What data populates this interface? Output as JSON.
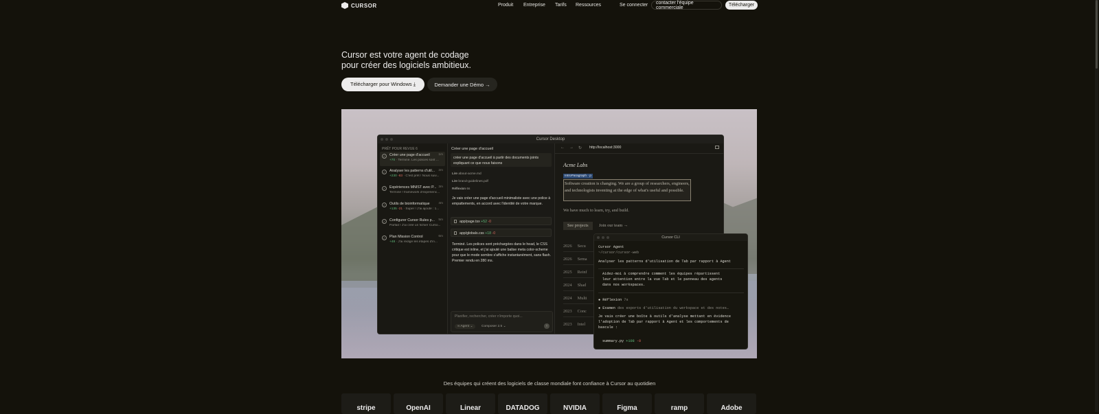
{
  "nav": {
    "logo_text": "CURSOR",
    "links": [
      "Produit",
      "Entreprise",
      "Tarifs",
      "Ressources"
    ],
    "connect": "Se connecter",
    "contact": "contacter l'équipe commerciale",
    "download": "Télécharger"
  },
  "hero": {
    "title_line1": "Cursor est votre agent de codage",
    "title_line2": "pour créer des logiciels ambitieux.",
    "primary_button": "Télécharger pour Windows ⤓",
    "secondary_button": "Demander une Démo →"
  },
  "desktop": {
    "window_title": "Cursor Desktop",
    "sidebar": {
      "heading": "PRÊT POUR REVUE 6",
      "items": [
        {
          "title": "Créer une page d'accueil",
          "added": "+70",
          "removed": "",
          "sub": "· Terminé. Les polices sont ...",
          "time": "1m"
        },
        {
          "title": "Analyser les patterns d'util...",
          "added": "+230",
          "removed": "-83",
          "sub": "· C'est prêt ! Nous suiv...",
          "time": "2m"
        },
        {
          "title": "Expériences MNIST avec P...",
          "added": "",
          "removed": "",
          "sub": "Terminé ! framework d'expérienc...",
          "time": "3m"
        },
        {
          "title": "Outils de bioinformatique",
          "added": "+135",
          "removed": "-21",
          "sub": "· Super ! J'ai ajouté : 1...",
          "time": "4m"
        },
        {
          "title": "Configurer Cursor Rules p...",
          "added": "",
          "removed": "",
          "sub": "Parfait ! J'ai créé un fichier Curso...",
          "time": "5m"
        },
        {
          "title": "Plan Mission Control",
          "added": "+48",
          "removed": "",
          "sub": "· J'ai rédigé les étapes d'in...",
          "time": "6m"
        }
      ]
    },
    "chat": {
      "title": "Créer une page d'accueil",
      "prompt": "créer une page d'accueil à partir des documents joints expliquant ce que nous faisons",
      "read1_label": "Lire",
      "read1_file": "about-acme.md",
      "read2_label": "Lire",
      "read2_file": "brand-guidelines.pdf",
      "think_label": "Réflexion",
      "think_time": "6s",
      "plan": "Je vais créer une page d'accueil minimaliste avec une police à empattements, en accord avec l'identité de votre marque.",
      "files": [
        {
          "name": "app/page.tsx",
          "added": "+52",
          "removed": "-0"
        },
        {
          "name": "app/globals.css",
          "added": "+18",
          "removed": "-0"
        }
      ],
      "summary": "Terminé. Les polices sont préchargées dans le head, le CSS critique est inline, et j'ai ajouté une balise meta color-scheme pour que le mode sombre s'affiche instantanément, sans flash. Premier rendu en 280 ms.",
      "input_placeholder": "Planifier, rechercher, créer n'importe quoi...",
      "agent_label": "∞ Agent ⌄",
      "model_label": "Composer 2.5 ⌄",
      "send_icon": "↑"
    },
    "browser": {
      "url": "http://localhost:3000",
      "back": "←",
      "forward": "→",
      "reload": "↻",
      "site_name": "Acme Labs",
      "tag": "IntroParagraph · p",
      "intro": "Software creation is changing. We are a group of researchers, engineers, and technologists inventing at the edge of what's useful and possible.",
      "line2": "We have much to learn, try, and build.",
      "btn_projects": "See projects",
      "btn_team": "Join our team →",
      "years": [
        {
          "year": "2026",
          "text": "Secu"
        },
        {
          "year": "2026",
          "text": "Sema"
        },
        {
          "year": "2025",
          "text": "Reinf"
        },
        {
          "year": "2024",
          "text": "Shad"
        },
        {
          "year": "2024",
          "text": "Multi"
        },
        {
          "year": "2023",
          "text": "Conc"
        },
        {
          "year": "2023",
          "text": "Intel"
        }
      ]
    }
  },
  "cli": {
    "title": "Cursor CLI",
    "agent": "Cursor Agent",
    "path": "~/cursor/cursor-web",
    "command": "Analyser les patterns d'utilisation de Tab par rapport à Agent",
    "box_text": "Aidez-moi à comprendre comment les équipes répartissent\nleur attention entre la vue Tab et le panneau des agents\ndans nos workspaces.",
    "think": "Réflexion",
    "think_time": "7s",
    "exam_label": "Examen",
    "exam_text": "des exports d'utilisation du workspace et des notes…",
    "plan": "Je vais créer une boîte à outils d'analyse mettant en évidence\nl'adoption de Tab par rapport à Agent et les comportements de\nbascule :",
    "file": "summary.py",
    "file_added": "+108",
    "file_removed": "-0"
  },
  "trusted": {
    "text": "Des équipes qui créent des logiciels de classe mondiale font confiance à Cursor au quotidien",
    "logos": [
      "stripe",
      "OpenAI",
      "Linear",
      "DATADOG",
      "NVIDIA",
      "Figma",
      "ramp",
      "Adobe"
    ]
  }
}
